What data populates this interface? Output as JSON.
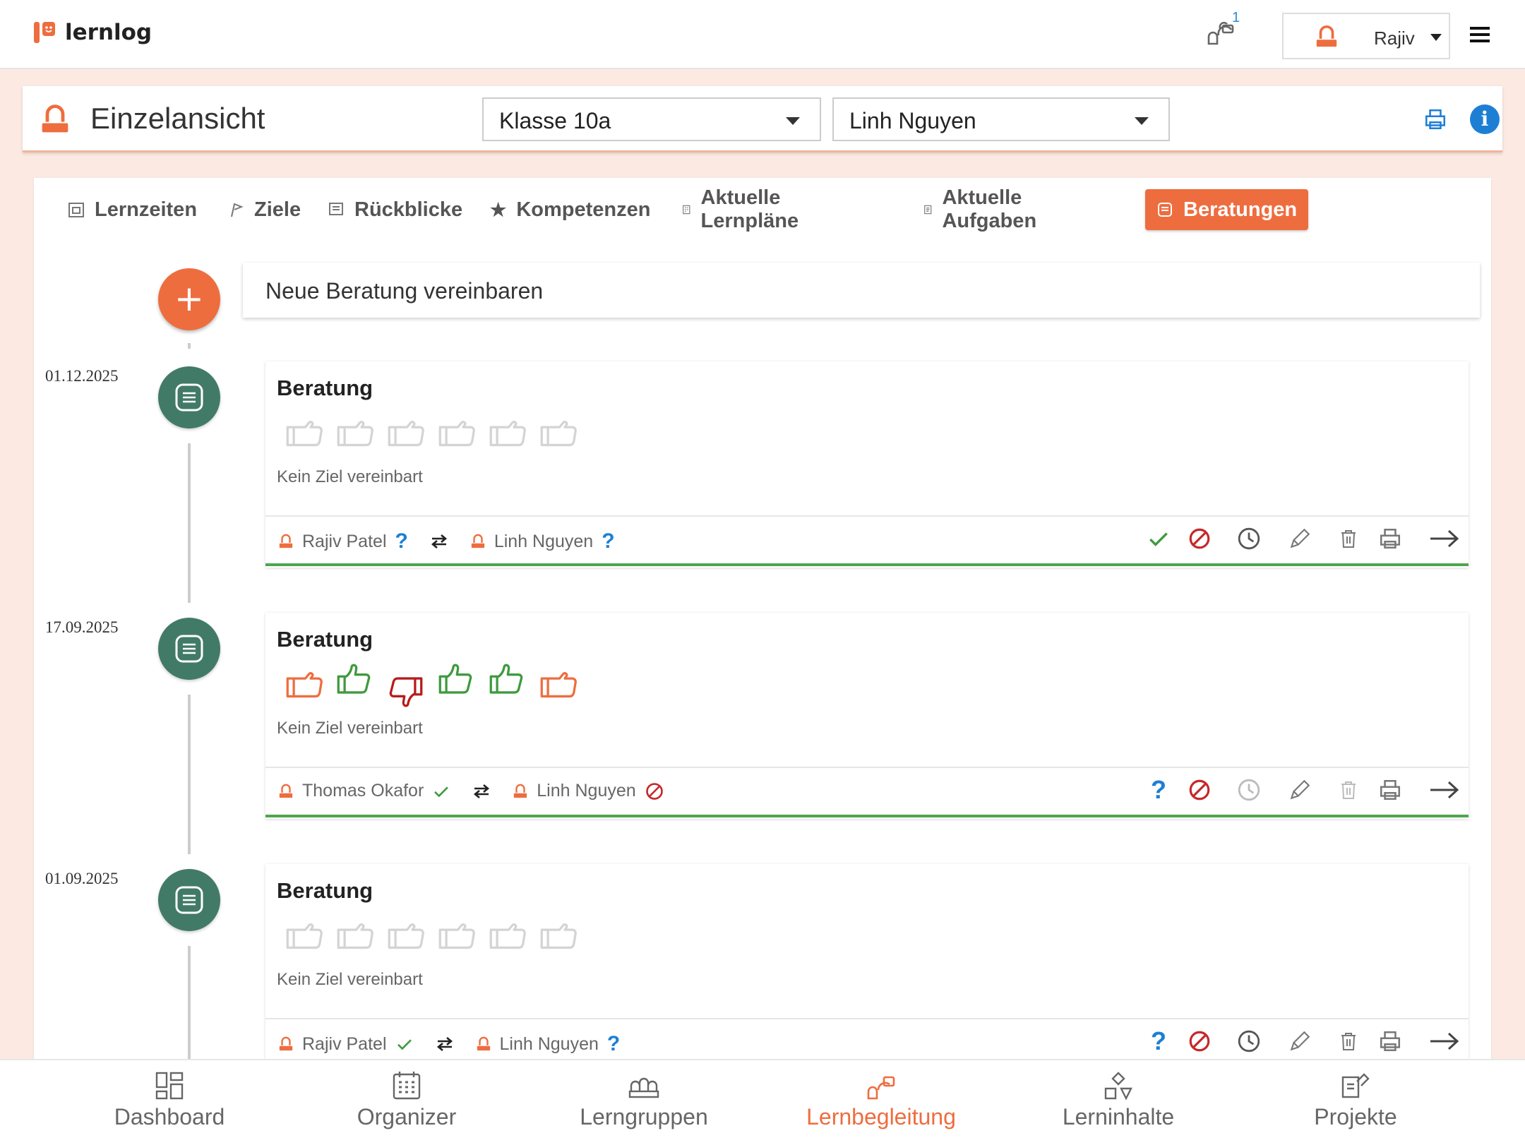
{
  "app": {
    "name": "lernlog"
  },
  "topbar": {
    "notification_count": "1",
    "user_name": "Rajiv"
  },
  "header": {
    "title": "Einzelansicht",
    "class_select": "Klasse 10a",
    "student_select": "Linh Nguyen"
  },
  "tabs": [
    {
      "label": "Lernzeiten",
      "icon": "calendar-icon"
    },
    {
      "label": "Ziele",
      "icon": "flag-icon"
    },
    {
      "label": "Rückblicke",
      "icon": "note-icon"
    },
    {
      "label": "Kompetenzen",
      "icon": "star-icon"
    },
    {
      "label": "Aktuelle Lernpläne",
      "icon": "plan-icon"
    },
    {
      "label": "Aktuelle Aufgaben",
      "icon": "task-icon"
    },
    {
      "label": "Beratungen",
      "icon": "consultation-icon",
      "active": true
    }
  ],
  "new_consultation": {
    "label": "Neue Beratung vereinbaren"
  },
  "colors": {
    "accent": "#ee6d3f",
    "node": "#427a68",
    "success": "#4da64d",
    "danger": "#c62828",
    "info": "#1d7fd4"
  },
  "consultations": [
    {
      "date": "01.12.2025",
      "title": "Beratung",
      "ratings": [
        "none",
        "none",
        "none",
        "none",
        "none",
        "none"
      ],
      "goal_text": "Kein Ziel vereinbart",
      "teacher": "Rajiv Patel",
      "teacher_status": "question",
      "student": "Linh Nguyen",
      "student_status": "question",
      "first_action": "check"
    },
    {
      "date": "17.09.2025",
      "title": "Beratung",
      "ratings": [
        "neutral",
        "up",
        "down",
        "up",
        "up",
        "neutral"
      ],
      "goal_text": "Kein Ziel vereinbart",
      "teacher": "Thomas Okafor",
      "teacher_status": "check",
      "student": "Linh Nguyen",
      "student_status": "declined",
      "first_action": "question"
    },
    {
      "date": "01.09.2025",
      "title": "Beratung",
      "ratings": [
        "none",
        "none",
        "none",
        "none",
        "none",
        "none"
      ],
      "goal_text": "Kein Ziel vereinbart",
      "teacher": "Rajiv Patel",
      "teacher_status": "check",
      "student": "Linh Nguyen",
      "student_status": "question",
      "first_action": "question"
    }
  ],
  "bottom_nav": [
    {
      "label": "Dashboard",
      "icon": "dashboard-icon"
    },
    {
      "label": "Organizer",
      "icon": "calendar-grid-icon"
    },
    {
      "label": "Lerngruppen",
      "icon": "group-icon"
    },
    {
      "label": "Lernbegleitung",
      "icon": "mentoring-icon",
      "active": true
    },
    {
      "label": "Lerninhalte",
      "icon": "shapes-icon"
    },
    {
      "label": "Projekte",
      "icon": "projects-icon"
    }
  ]
}
